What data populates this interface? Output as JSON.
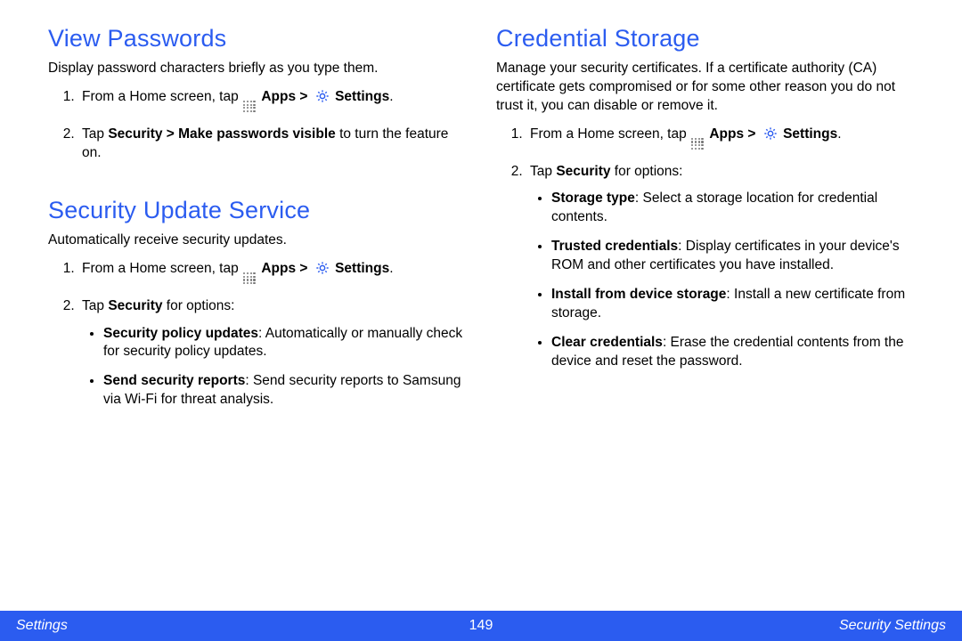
{
  "left_column": {
    "section1": {
      "heading": "View Passwords",
      "intro": "Display password characters briefly as you type them.",
      "step1_prefix": "From a Home screen, tap ",
      "step1_apps": "Apps > ",
      "step1_settings": "Settings",
      "step1_suffix": ".",
      "step2_prefix": "Tap ",
      "step2_bold": "Security > Make passwords visible",
      "step2_suffix": " to turn the feature on."
    },
    "section2": {
      "heading": "Security Update Service",
      "intro": "Automatically receive security updates.",
      "step1_prefix": "From a Home screen, tap ",
      "step1_apps": "Apps > ",
      "step1_settings": "Settings",
      "step1_suffix": ".",
      "step2_prefix": "Tap ",
      "step2_bold": "Security",
      "step2_suffix": " for options:",
      "bullet1_bold": "Security policy updates",
      "bullet1_rest": ": Automatically or manually check for security policy updates.",
      "bullet2_bold": "Send security reports",
      "bullet2_rest": ": Send security reports to Samsung via Wi-Fi for threat analysis."
    }
  },
  "right_column": {
    "section1": {
      "heading": "Credential Storage",
      "intro": "Manage your security certificates. If a certificate authority (CA) certificate gets compromised or for some other reason you do not trust it, you can disable or remove it.",
      "step1_prefix": "From a Home screen, tap ",
      "step1_apps": "Apps > ",
      "step1_settings": "Settings",
      "step1_suffix": ".",
      "step2_prefix": "Tap ",
      "step2_bold": "Security",
      "step2_suffix": " for options:",
      "bullet1_bold": "Storage type",
      "bullet1_rest": ": Select a storage location for credential contents.",
      "bullet2_bold": "Trusted credentials",
      "bullet2_rest": ": Display certificates in your device's ROM and other certificates you have installed.",
      "bullet3_bold": "Install from device storage",
      "bullet3_rest": ": Install a new certificate from storage.",
      "bullet4_bold": "Clear credentials",
      "bullet4_rest": ": Erase the credential contents from the device and reset the password."
    }
  },
  "footer": {
    "left": "Settings",
    "center": "149",
    "right": "Security Settings"
  }
}
